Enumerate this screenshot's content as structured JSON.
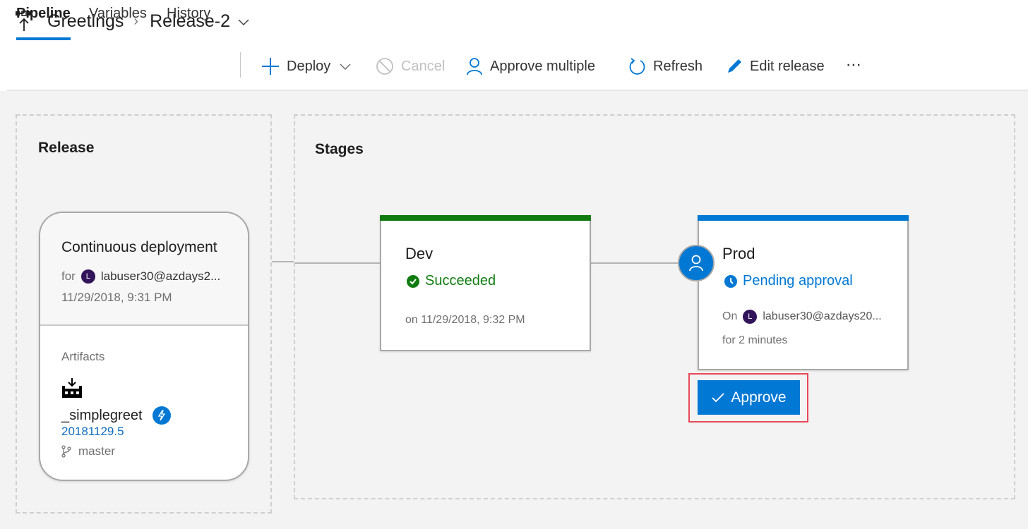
{
  "header": {
    "breadcrumb": {
      "project": "Greetings",
      "release": "Release-2"
    },
    "tabs": [
      {
        "label": "Pipeline",
        "active": true
      },
      {
        "label": "Variables",
        "active": false
      },
      {
        "label": "History",
        "active": false
      }
    ],
    "commands": {
      "deploy": "Deploy",
      "cancel": "Cancel",
      "approve_multiple": "Approve multiple",
      "refresh": "Refresh",
      "edit_release": "Edit release",
      "more": "⋯"
    }
  },
  "release_section": {
    "title": "Release",
    "card": {
      "trigger": "Continuous deployment",
      "for_label": "for",
      "avatar_initial": "L",
      "user": "labuser30@azdays2...",
      "date": "11/29/2018, 9:31 PM",
      "artifacts_label": "Artifacts",
      "artifact_name": "_simplegreet",
      "build_number": "20181129.5",
      "branch": "master"
    }
  },
  "stages_section": {
    "title": "Stages",
    "stages": [
      {
        "name": "Dev",
        "status": "Succeeded",
        "status_color": "#107c10",
        "detail": "on 11/29/2018, 9:32 PM"
      },
      {
        "name": "Prod",
        "status": "Pending approval",
        "status_color": "#0078d4",
        "on_label": "On",
        "avatar_initial": "L",
        "user": "labuser30@azdays20...",
        "duration": "for 2 minutes",
        "action": "Approve"
      }
    ]
  },
  "colors": {
    "accent": "#0078d4",
    "success": "#107c10",
    "highlight": "#e74856",
    "avatar": "#32145a"
  }
}
